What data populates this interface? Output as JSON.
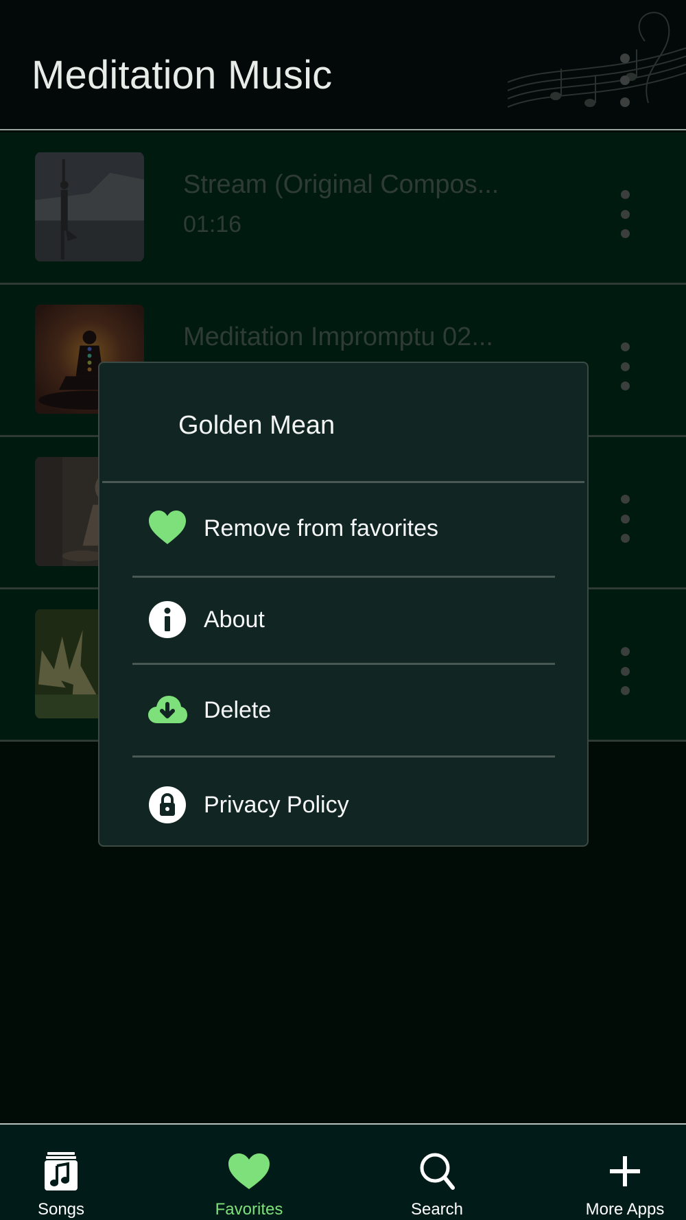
{
  "header": {
    "title": "Meditation Music"
  },
  "songs": [
    {
      "title": "Stream (Original Compos...",
      "duration": "01:16",
      "thumb": "yoga-pose"
    },
    {
      "title": "Meditation Impromptu 02...",
      "duration": "",
      "thumb": "chakra-sunset"
    },
    {
      "title": "",
      "duration": "",
      "thumb": "buddha-statue"
    },
    {
      "title": "",
      "duration": "",
      "thumb": "lotus-flower"
    }
  ],
  "dialog": {
    "title": "Golden Mean",
    "items": [
      {
        "label": "Remove from favorites",
        "icon": "heart-icon"
      },
      {
        "label": "About",
        "icon": "info-icon"
      },
      {
        "label": "Delete",
        "icon": "cloud-download-icon"
      },
      {
        "label": "Privacy Policy",
        "icon": "lock-icon"
      }
    ]
  },
  "nav": {
    "active": "Favorites",
    "items": [
      {
        "label": "Songs",
        "icon": "music-note-icon"
      },
      {
        "label": "Favorites",
        "icon": "heart-icon"
      },
      {
        "label": "Search",
        "icon": "search-icon"
      },
      {
        "label": "More Apps",
        "icon": "plus-icon"
      }
    ]
  },
  "colors": {
    "accent": "#7de07a",
    "background": "#020c07",
    "dialog": "#112622",
    "row": "#011a0f",
    "nav": "#011b18"
  }
}
